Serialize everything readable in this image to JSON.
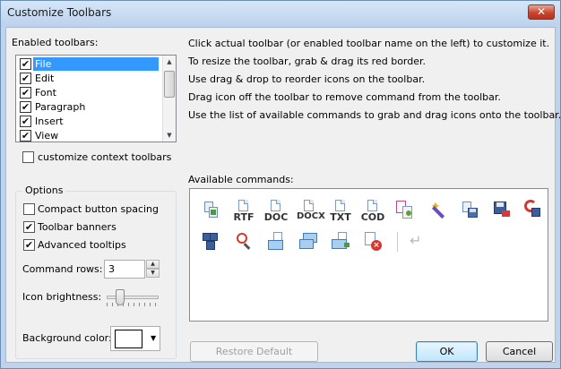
{
  "window": {
    "title": "Customize Toolbars",
    "close_glyph": "✕"
  },
  "enabled_toolbars": {
    "label": "Enabled toolbars:",
    "items": [
      {
        "label": "File",
        "checked": true,
        "selected": true
      },
      {
        "label": "Edit",
        "checked": true
      },
      {
        "label": "Font",
        "checked": true
      },
      {
        "label": "Paragraph",
        "checked": true
      },
      {
        "label": "Insert",
        "checked": true
      },
      {
        "label": "View",
        "checked": true
      }
    ]
  },
  "context_toolbars": {
    "label": "customize context toolbars",
    "checked": false
  },
  "instructions": [
    "Click actual toolbar (or enabled toolbar name on the left) to customize it.",
    "To resize the toolbar, grab & drag its red border.",
    "Use drag & drop to reorder icons on the toolbar.",
    "Drag icon off the toolbar to remove command from the toolbar.",
    "Use the list of available commands to grab and drag icons onto the toolbar."
  ],
  "options": {
    "legend": "Options",
    "compact_spacing": {
      "label": "Compact button spacing",
      "checked": false
    },
    "toolbar_banners": {
      "label": "Toolbar banners",
      "checked": true
    },
    "advanced_tooltips": {
      "label": "Advanced tooltips",
      "checked": true
    },
    "command_rows": {
      "label": "Command rows:",
      "value": "3"
    },
    "icon_brightness": {
      "label": "Icon brightness:",
      "level": 0.3
    },
    "background_color": {
      "label": "Background color:",
      "value": "#ffffff"
    }
  },
  "available_commands": {
    "label": "Available commands:",
    "row1": [
      {
        "icon": "copy-format-icon"
      },
      {
        "icon": "rtf-doc-icon",
        "text": "RTF"
      },
      {
        "icon": "doc-icon",
        "text": "DOC"
      },
      {
        "icon": "docx-icon",
        "text": "DOCX"
      },
      {
        "icon": "txt-doc-icon",
        "text": "TXT"
      },
      {
        "icon": "cod-doc-icon",
        "text": "COD"
      },
      {
        "icon": "compare-docs-icon"
      },
      {
        "icon": "magic-wand-icon"
      },
      {
        "icon": "save-all-icon"
      },
      {
        "icon": "save-icon"
      },
      {
        "icon": "save-restore-icon"
      }
    ],
    "row2": [
      {
        "icon": "save-multiple-icon"
      },
      {
        "icon": "find-icon"
      },
      {
        "icon": "email-doc-icon"
      },
      {
        "icon": "email-multiple-icon"
      },
      {
        "icon": "email-forward-icon"
      },
      {
        "icon": "close-doc-icon"
      },
      {
        "icon": "separator-icon"
      },
      {
        "icon": "return-arrow-icon"
      }
    ]
  },
  "buttons": {
    "restore": "Restore Default",
    "ok": "OK",
    "cancel": "Cancel"
  },
  "colors": {
    "selection": "#3399ff",
    "frame": "#bfd4ea",
    "client": "#f0f0f0"
  }
}
